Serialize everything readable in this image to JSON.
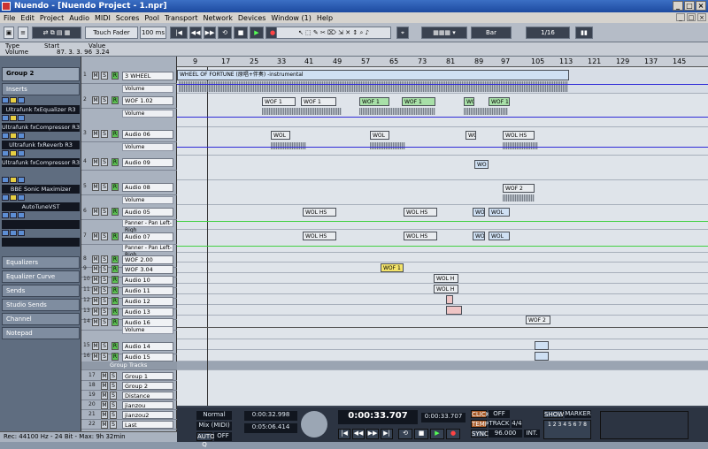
{
  "window": {
    "title": "Nuendo - [Nuendo Project - 1.npr]",
    "controls": [
      "_",
      "□",
      "×"
    ]
  },
  "menu": [
    "File",
    "Edit",
    "Project",
    "Audio",
    "MIDI",
    "Scores",
    "Pool",
    "Transport",
    "Network",
    "Devices",
    "Window (1)",
    "Help"
  ],
  "toolbar": {
    "automation_mode": "Touch Fader",
    "zoom": "100 ms",
    "snap": "Bar",
    "quantize": "1/16"
  },
  "infoline": {
    "type_label": "Type",
    "start_label": "Start",
    "value_label": "Value",
    "type_value": "Volume",
    "start_value": "87. 3. 3. 96",
    "value_value": "3.24"
  },
  "inspector": {
    "track_name": "Group 2",
    "inserts_label": "Inserts",
    "plugins": [
      "Ultrafunk fxEqualizer R3",
      "Ultrafunk fxCompressor R3",
      "Ultrafunk fxReverb R3",
      "Ultrafunk fxCompressor R3",
      "BBE Sonic Maximizer",
      "AutoTuneVST"
    ],
    "sections": [
      "Equalizers",
      "Equalizer Curve",
      "Sends",
      "Studio Sends",
      "Channel",
      "Notepad"
    ]
  },
  "ruler": [
    "9",
    "17",
    "25",
    "33",
    "41",
    "49",
    "57",
    "65",
    "73",
    "81",
    "89",
    "97",
    "105",
    "113",
    "121",
    "129",
    "137",
    "145"
  ],
  "tracks": [
    {
      "num": "1",
      "name": "3 WHEEL",
      "sub": "Volume"
    },
    {
      "num": "2",
      "name": "WOF 1.02",
      "sub": "Volume"
    },
    {
      "num": "3",
      "name": "Audio 06",
      "sub": "Volume"
    },
    {
      "num": "4",
      "name": "Audio 09",
      "sub": ""
    },
    {
      "num": "5",
      "name": "Audio 08",
      "sub": "Volume"
    },
    {
      "num": "6",
      "name": "Audio 05",
      "sub": "Panner - Pan Left-Righ"
    },
    {
      "num": "7",
      "name": "Audio 07",
      "sub": "Panner - Pan Left-Righ"
    },
    {
      "num": "8",
      "name": "WOF 2.00",
      "sub": ""
    },
    {
      "num": "9",
      "name": "WOF 3.04",
      "sub": ""
    },
    {
      "num": "10",
      "name": "Audio 10",
      "sub": ""
    },
    {
      "num": "11",
      "name": "Audio 11",
      "sub": ""
    },
    {
      "num": "12",
      "name": "Audio 12",
      "sub": ""
    },
    {
      "num": "13",
      "name": "Audio 13",
      "sub": ""
    },
    {
      "num": "14",
      "name": "Audio 16",
      "sub": "Volume"
    },
    {
      "num": "15",
      "name": "Audio 14",
      "sub": ""
    },
    {
      "num": "16",
      "name": "Audio 15",
      "sub": ""
    }
  ],
  "group_folder": "Group Tracks",
  "group_tracks": [
    {
      "num": "17",
      "name": "Group 1"
    },
    {
      "num": "18",
      "name": "Group 2"
    },
    {
      "num": "19",
      "name": "Distance"
    },
    {
      "num": "20",
      "name": "jianzou"
    },
    {
      "num": "21",
      "name": "jianzou2"
    },
    {
      "num": "22",
      "name": "Last"
    }
  ],
  "clips": {
    "top": "WHEEL  OF  FORTUNE (原唱+伴奏) -instrumental",
    "wof1": "WOF 1",
    "wol": "WOL",
    "wolhs": "WOL HS",
    "wof2": "WOF 2",
    "wo": "WO",
    "wolhs1": "WOL H",
    "wol_short": "WOL"
  },
  "transport": {
    "mode": "Normal",
    "sync": "Mix (MIDI)",
    "auto": "AUTO Q",
    "off": "OFF",
    "left_locator": "0:00:32.998",
    "right_locator": "0:05:06.414",
    "position": "0:00:33.707",
    "position_secondary": "0:00:33.707",
    "click_label": "CLICK",
    "click_state": "OFF",
    "tempo_label": "TEMPO",
    "tempo_track": "TRACK",
    "signature": "4/4",
    "tempo_value": "96.000",
    "sync_label": "SYNC",
    "sync_state": "INT.",
    "show_label": "SHOW",
    "marker_label": "MARKER"
  },
  "status": "Rec: 44100 Hz - 24 Bit - Max: 9h 32min",
  "colors": {
    "accent": "#2f2ad8",
    "automation_green": "#43d043"
  }
}
